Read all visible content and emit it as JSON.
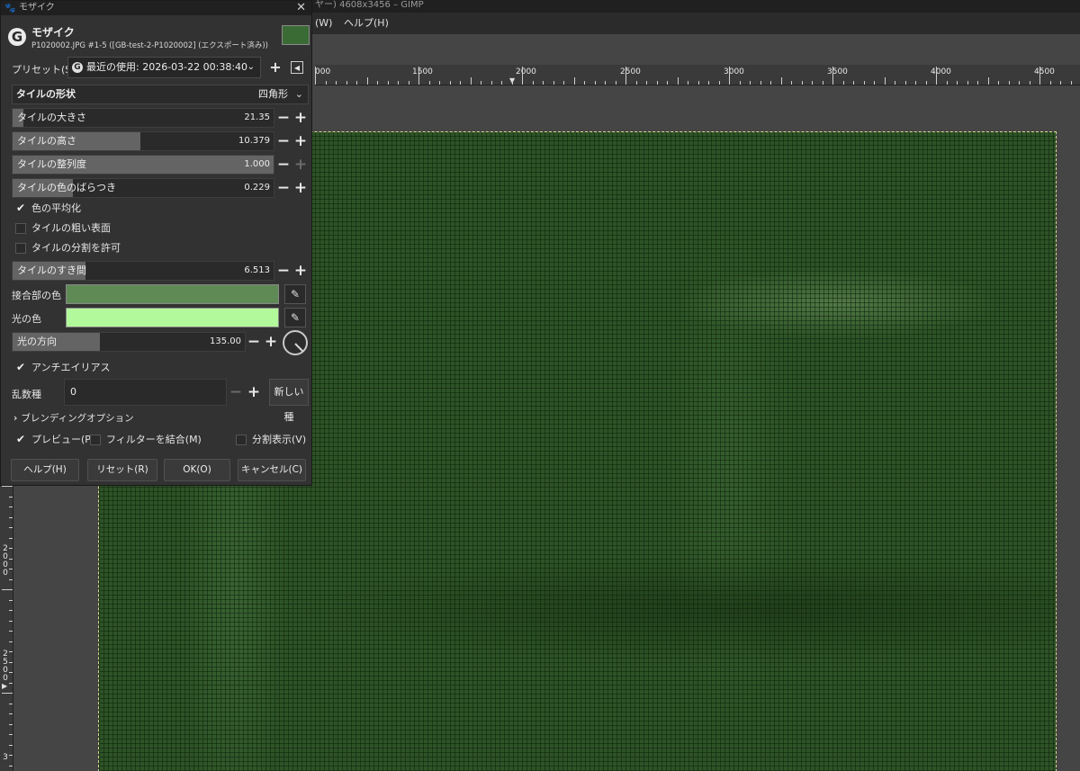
{
  "main_window": {
    "title": "ヤー) 4608x3456 – GIMP",
    "menu": [
      "(W)",
      "ヘルプ(H)"
    ]
  },
  "ruler": {
    "h_labels": [
      "000",
      "1500",
      "2000",
      "2500",
      "3000",
      "3500",
      "4000",
      "4500"
    ],
    "v_labels": [
      "2000",
      "2500",
      "3"
    ]
  },
  "dialog": {
    "window_title": "モザイク",
    "filter_name": "モザイク",
    "subtitle": "P1020002.JPG #1-5 ([GB-test-2-P1020002] (エクスポート済み))",
    "preset_label": "プリセット(S):",
    "preset_value": "最近の使用: 2026-03-22 00:38:40",
    "tile_shape": {
      "label": "タイルの形状",
      "value": "四角形"
    },
    "sliders": [
      {
        "label": "タイルの大きさ",
        "value": "21.35",
        "fraction": 0.04,
        "minus_enabled": true,
        "plus_enabled": true
      },
      {
        "label": "タイルの高さ",
        "value": "10.379",
        "fraction": 0.49,
        "minus_enabled": true,
        "plus_enabled": true
      },
      {
        "label": "タイルの整列度",
        "value": "1.000",
        "fraction": 1.0,
        "minus_enabled": true,
        "plus_enabled": false
      },
      {
        "label": "タイルの色のばらつき",
        "value": "0.229",
        "fraction": 0.23,
        "minus_enabled": true,
        "plus_enabled": true
      }
    ],
    "checks": [
      {
        "label": "色の平均化",
        "checked": true
      },
      {
        "label": "タイルの粗い表面",
        "checked": false
      },
      {
        "label": "タイルの分割を許可",
        "checked": false
      }
    ],
    "tile_spacing": {
      "label": "タイルのすき間",
      "value": "6.513",
      "fraction": 0.28
    },
    "joint_color": {
      "label": "接合部の色",
      "color": "#5f8a55"
    },
    "light_color": {
      "label": "光の色",
      "color": "#b2f99b"
    },
    "light_direction": {
      "label": "光の方向",
      "value": "135.00",
      "fraction": 0.375
    },
    "antialias": {
      "label": "アンチエイリアス",
      "checked": true
    },
    "seed": {
      "label": "乱数種",
      "value": "0",
      "new_seed_label": "新しい種"
    },
    "blending": {
      "label": "ブレンディングオプション"
    },
    "preview": {
      "label": "プレビュー(P)",
      "checked": true
    },
    "merge_filter": {
      "label": "フィルターを結合(M)",
      "checked": false
    },
    "split_view": {
      "label": "分割表示(V)",
      "checked": false
    },
    "buttons": {
      "help": "ヘルプ(H)",
      "reset": "リセット(R)",
      "ok": "OK(O)",
      "cancel": "キャンセル(C)"
    }
  },
  "icons": {
    "add": "+",
    "menu": "◂",
    "dropdown": "⌄",
    "minus": "−",
    "plus": "+",
    "picker": "✎",
    "check": "✔",
    "expand": "›",
    "close": "✕"
  }
}
